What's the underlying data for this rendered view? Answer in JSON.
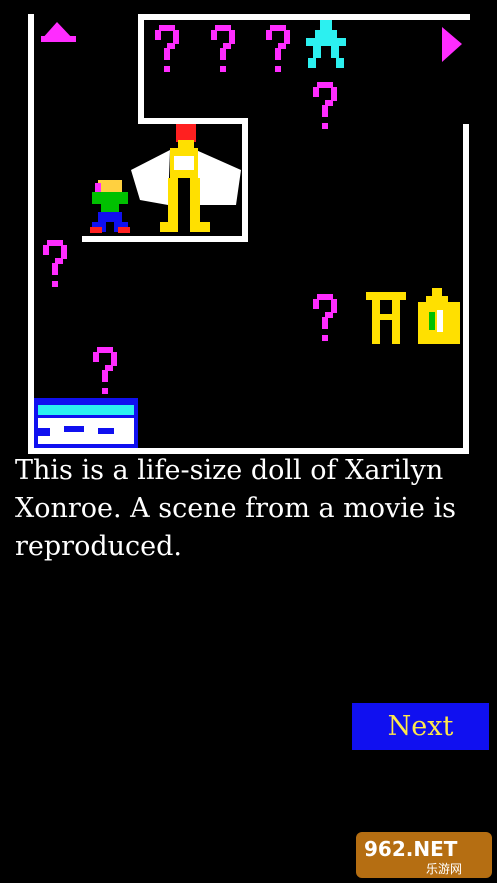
{
  "room": {
    "description": "This is a life-size doll of Xarilyn Xonroe. A scene from a movie is reproduced.",
    "colors": {
      "wall": "#ffffff",
      "question_mark": "#ff2cff",
      "ghost": "#2cf0f0",
      "player_shirt": "#00c000",
      "player_head": "#ffd040",
      "player_legs": "#1010f0",
      "doll_dress": "#ffffff",
      "doll_body": "#ffe000",
      "doll_hair": "#ff2020",
      "torii": "#ffe000",
      "bag": "#ffe000",
      "bed_frame": "#1010f0",
      "bed_sheet": "#2cf0f0"
    },
    "icons": [
      "up-arrow-icon",
      "right-arrow-icon",
      "question-mark-icon",
      "ghost-icon",
      "player-icon",
      "doll-icon",
      "torii-icon",
      "money-bag-icon",
      "bed-icon"
    ]
  },
  "controls": {
    "next_label": "Next"
  },
  "watermark": {
    "text": "962.NET",
    "subtext": "乐游网"
  }
}
